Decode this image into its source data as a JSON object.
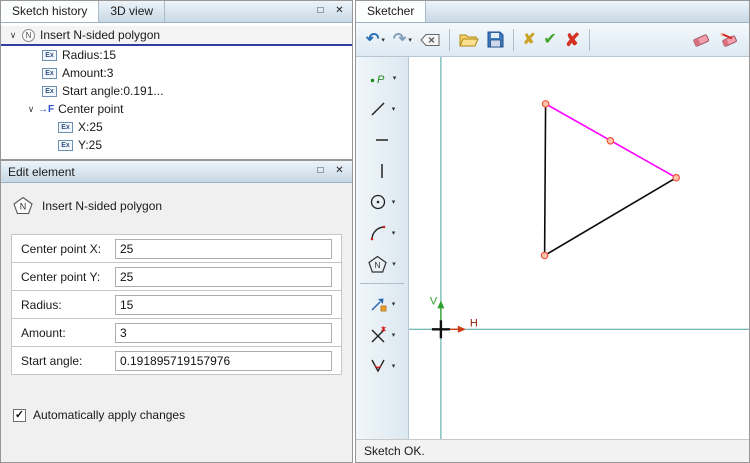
{
  "window_glyphs": {
    "maximize": "□",
    "close": "✕",
    "chevron_open": "∨",
    "dropdown": "▾"
  },
  "icons": {
    "polygon_letter": "N",
    "point_letter": "P",
    "ex": "Ex",
    "center_point": "→F"
  },
  "history_panel": {
    "tabs": [
      {
        "label": "Sketch history"
      },
      {
        "label": "3D view"
      }
    ],
    "tree": {
      "root_label": "Insert N-sided polygon",
      "items": [
        {
          "label": "Radius:15"
        },
        {
          "label": "Amount:3"
        },
        {
          "label": "Start angle:0.191..."
        },
        {
          "label": "Center point"
        },
        {
          "label": "X:25"
        },
        {
          "label": "Y:25"
        }
      ]
    }
  },
  "edit_panel": {
    "title": "Edit element",
    "header_label": "Insert N-sided polygon",
    "fields": [
      {
        "label": "Center point X:",
        "value": "25"
      },
      {
        "label": "Center point Y:",
        "value": "25"
      },
      {
        "label": "Radius:",
        "value": "15"
      },
      {
        "label": "Amount:",
        "value": "3"
      },
      {
        "label": "Start angle:",
        "value": "0.191895719157976"
      }
    ],
    "auto_apply": {
      "label": "Automatically apply changes",
      "checked": true,
      "check_glyph": "✓"
    }
  },
  "sketcher": {
    "tab_label": "Sketcher",
    "toolbar": {
      "undo": "↶",
      "redo": "↷",
      "cancel": "✘",
      "accept": "✔",
      "delete": "✘"
    },
    "axes": {
      "v_label": "V",
      "h_label": "H"
    },
    "status": "Sketch OK."
  }
}
